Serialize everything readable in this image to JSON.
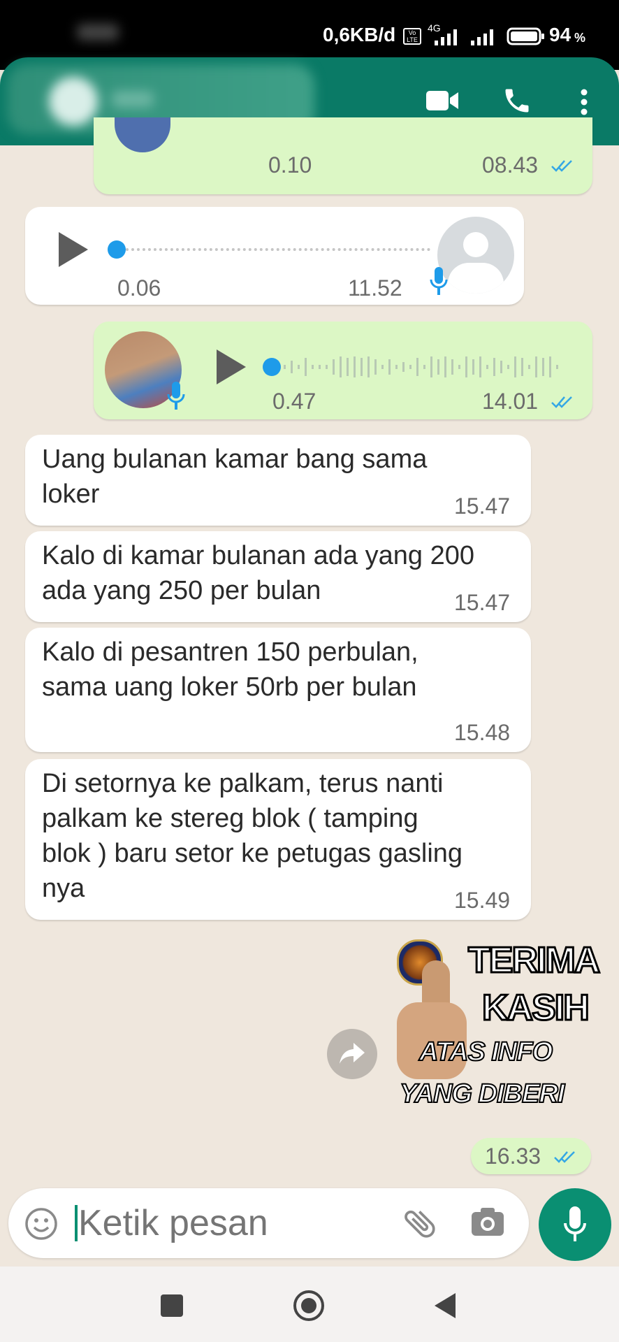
{
  "status_bar": {
    "network_speed": "0,6KB/d",
    "network_type": "4G",
    "battery": "94",
    "battery_unit": "%"
  },
  "header": {
    "contact_name": "",
    "video_call_icon": "video-call-icon",
    "call_icon": "phone-icon",
    "menu_icon": "more-vert-icon"
  },
  "messages": [
    {
      "type": "voice",
      "direction": "out",
      "duration": "0.10",
      "time": "08.43",
      "read": true
    },
    {
      "type": "voice",
      "direction": "in",
      "position": "0.06",
      "time": "11.52"
    },
    {
      "type": "voice",
      "direction": "out",
      "position": "0.47",
      "time": "14.01",
      "read": true
    },
    {
      "type": "text",
      "direction": "in",
      "text": "Uang bulanan kamar bang sama\nloker",
      "time": "15.47"
    },
    {
      "type": "text",
      "direction": "in",
      "text": "Kalo di kamar bulanan ada yang 200\nada yang 250 per bulan",
      "time": "15.47"
    },
    {
      "type": "text",
      "direction": "in",
      "text": "Kalo di pesantren 150 perbulan,\nsama uang loker 50rb per bulan",
      "time": "15.48"
    },
    {
      "type": "text",
      "direction": "in",
      "text": "Di setornya ke palkam, terus nanti\npalkam ke stereg blok ( tamping\nblok ) baru setor ke petugas gasling\nnya",
      "time": "15.49"
    },
    {
      "type": "sticker",
      "direction": "out",
      "lines": [
        "TERIMA",
        "KASIH",
        "ATAS INFO",
        "YANG DIBERI"
      ],
      "time": "16.33",
      "read": true
    }
  ],
  "input": {
    "placeholder": "Ketik pesan"
  },
  "colors": {
    "header": "#0a7a66",
    "accent": "#0a8f72",
    "outgoing_bubble": "#dcf7c5",
    "incoming_bubble": "#ffffff",
    "chat_bg": "#efe7dd",
    "read_tick": "#34a7e5",
    "voice_dot": "#1e9be9"
  }
}
